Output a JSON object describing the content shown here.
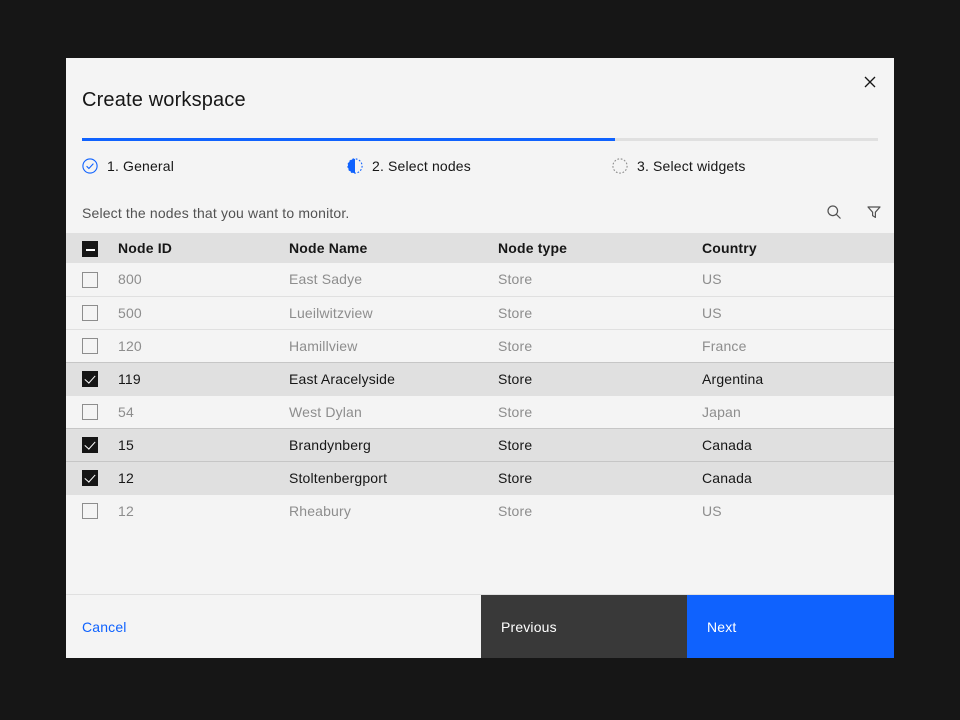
{
  "modal": {
    "title": "Create workspace",
    "close_icon": "close-icon"
  },
  "progress": {
    "fill_percent": 67,
    "accent_color": "#0f62fe",
    "track_color": "#e0e0e0",
    "steps": [
      {
        "label": "1. General",
        "state": "complete",
        "icon": "check-circle-icon"
      },
      {
        "label": "2. Select nodes",
        "state": "current",
        "icon": "half-circle-icon"
      },
      {
        "label": "3. Select widgets",
        "state": "incomplete",
        "icon": "dashed-circle-icon"
      }
    ]
  },
  "toolbar": {
    "description": "Select the nodes that you want to monitor.",
    "search_icon": "search-icon",
    "filter_icon": "filter-icon"
  },
  "table": {
    "select_all_state": "indeterminate",
    "columns": [
      "Node ID",
      "Node Name",
      "Node type",
      "Country"
    ],
    "rows": [
      {
        "selected": false,
        "node_id": "800",
        "node_name": "East Sadye",
        "node_type": "Store",
        "country": "US"
      },
      {
        "selected": false,
        "node_id": "500",
        "node_name": "Lueilwitzview",
        "node_type": "Store",
        "country": "US"
      },
      {
        "selected": false,
        "node_id": "120",
        "node_name": "Hamillview",
        "node_type": "Store",
        "country": "France"
      },
      {
        "selected": true,
        "node_id": "119",
        "node_name": "East Aracelyside",
        "node_type": "Store",
        "country": "Argentina"
      },
      {
        "selected": false,
        "node_id": "54",
        "node_name": "West Dylan",
        "node_type": "Store",
        "country": "Japan"
      },
      {
        "selected": true,
        "node_id": "15",
        "node_name": "Brandynberg",
        "node_type": "Store",
        "country": "Canada"
      },
      {
        "selected": true,
        "node_id": "12",
        "node_name": "Stoltenbergport",
        "node_type": "Store",
        "country": "Canada"
      },
      {
        "selected": false,
        "node_id": "12",
        "node_name": "Rheabury",
        "node_type": "Store",
        "country": "US"
      }
    ]
  },
  "footer": {
    "cancel_label": "Cancel",
    "previous_label": "Previous",
    "next_label": "Next"
  }
}
